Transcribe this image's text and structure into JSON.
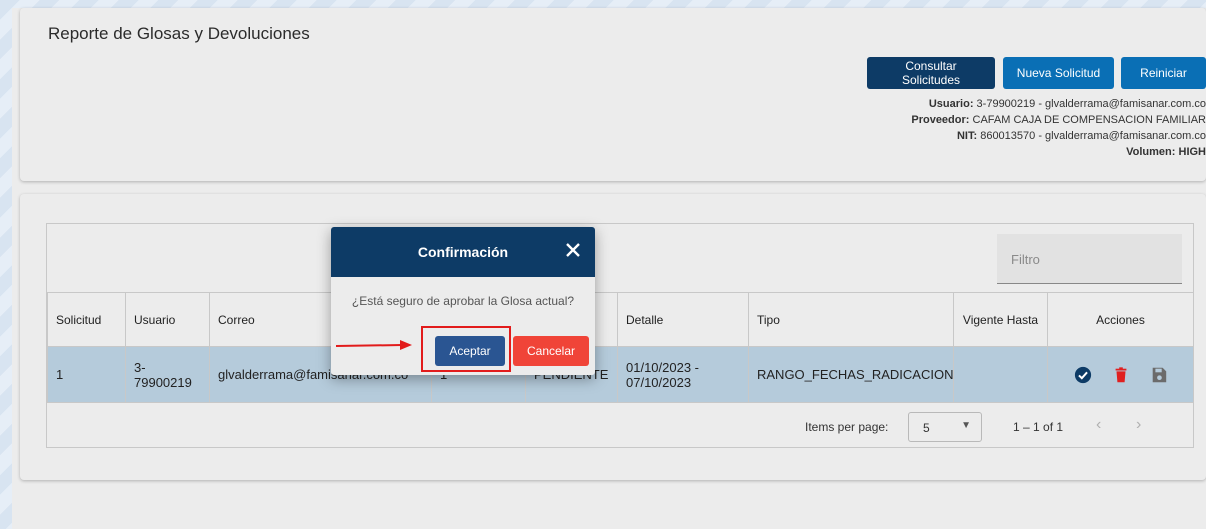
{
  "header": {
    "title": "Reporte de Glosas y Devoluciones",
    "buttons": {
      "consultar": "Consultar Solicitudes",
      "nueva": "Nueva Solicitud",
      "reiniciar": "Reiniciar"
    },
    "info": {
      "usuario_label": "Usuario:",
      "usuario_value": "3-79900219 - glvalderrama@famisanar.com.co",
      "proveedor_label": "Proveedor:",
      "proveedor_value": "CAFAM CAJA DE COMPENSACION FAMILIAR",
      "nit_label": "NIT:",
      "nit_value": "860013570 - glvalderrama@famisanar.com.co",
      "volumen_label": "Volumen:",
      "volumen_value": "HIGH"
    }
  },
  "table": {
    "filter_placeholder": "Filtro",
    "columns": [
      "Solicitud",
      "Usuario",
      "Correo",
      "",
      "",
      "Detalle",
      "Tipo",
      "Vigente Hasta",
      "Acciones"
    ],
    "rows": [
      {
        "solicitud": "1",
        "usuario": "3-\n79900219",
        "correo": "glvalderrama@famisanar.com.co",
        "col4": "1",
        "estado": "PENDIENTE",
        "detalle": "01/10/2023 -\n07/10/2023",
        "tipo": "RANGO_FECHAS_RADICACION",
        "vigente": ""
      }
    ]
  },
  "paginator": {
    "items_per_page_label": "Items per page:",
    "page_size": "5",
    "range": "1 – 1 of 1"
  },
  "modal": {
    "title": "Confirmación",
    "message": "¿Está seguro de aprobar la Glosa actual?",
    "accept": "Aceptar",
    "cancel": "Cancelar"
  },
  "colors": {
    "primary": "#0d3b66",
    "secondary": "#0a6fb5",
    "accept": "#2a5592",
    "danger": "#f04438",
    "row_highlight": "#b5cbdb",
    "annotation": "#e21b1b"
  },
  "icons": {
    "approve": "check-circle-icon",
    "delete": "trash-icon",
    "save": "floppy-disk-icon",
    "close": "close-icon"
  }
}
